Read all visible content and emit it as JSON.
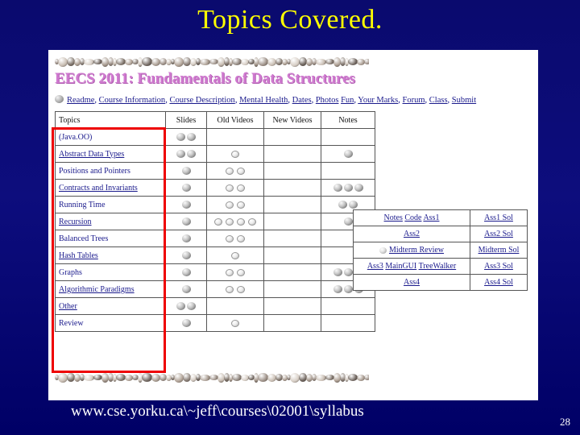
{
  "slide": {
    "title": "Topics Covered.",
    "footer_url": "www.cse.yorku.ca\\~jeff\\courses\\02001\\syllabus",
    "page_number": "28",
    "background_color": "#00007a",
    "title_color": "#ffff00"
  },
  "page": {
    "course_heading": "EECS 2011: Fundamentals of Data Structures",
    "heading_color": "#d07ad0",
    "nav_links": [
      "Readme",
      "Course Information",
      "Course Description",
      "Mental Health",
      "Dates",
      "Photos",
      "Fun",
      "Your Marks",
      "Forum",
      "Class",
      "Submit"
    ],
    "nav_bullet_icon": "rock-bullet-icon"
  },
  "topics_table": {
    "headers": [
      "Topics",
      "Slides",
      "Old Videos",
      "New Videos",
      "Notes"
    ],
    "rows": [
      {
        "topic": "(Java.OO)",
        "linked": false,
        "slides": 2,
        "old_videos": 0,
        "new_videos": 0,
        "notes": 0
      },
      {
        "topic": "Abstract Data Types",
        "linked": true,
        "slides": 2,
        "old_videos": 1,
        "new_videos": 0,
        "notes": 1
      },
      {
        "topic": "Positions and Pointers",
        "linked": false,
        "slides": 1,
        "old_videos": 2,
        "new_videos": 0,
        "notes": 0
      },
      {
        "topic": "Contracts and Invariants",
        "linked": true,
        "slides": 1,
        "old_videos": 2,
        "new_videos": 0,
        "notes": 3
      },
      {
        "topic": "Running Time",
        "linked": false,
        "slides": 1,
        "old_videos": 2,
        "new_videos": 0,
        "notes": 2
      },
      {
        "topic": "Recursion",
        "linked": true,
        "slides": 1,
        "old_videos": 4,
        "new_videos": 0,
        "notes": 1
      },
      {
        "topic": "Balanced Trees",
        "linked": false,
        "slides": 1,
        "old_videos": 2,
        "new_videos": 0,
        "notes": 0
      },
      {
        "topic": "Hash Tables",
        "linked": true,
        "slides": 1,
        "old_videos": 1,
        "new_videos": 0,
        "notes": 0
      },
      {
        "topic": "Graphs",
        "linked": false,
        "slides": 1,
        "old_videos": 2,
        "new_videos": 0,
        "notes": 3
      },
      {
        "topic": "Algorithmic Paradigms",
        "linked": true,
        "slides": 1,
        "old_videos": 2,
        "new_videos": 0,
        "notes": 3
      },
      {
        "topic": "Other",
        "linked": true,
        "slides": 2,
        "old_videos": 0,
        "new_videos": 0,
        "notes": 0
      },
      {
        "topic": "Review",
        "linked": false,
        "slides": 1,
        "old_videos": 1,
        "new_videos": 0,
        "notes": 0
      }
    ],
    "highlight_color": "#ee0000",
    "highlight_target": "Topics column"
  },
  "assignments_table": {
    "rows": [
      {
        "left_links": [
          "Notes",
          "Code",
          "Ass1"
        ],
        "left_icon": false,
        "right_link": "Ass1 Sol"
      },
      {
        "left_links": [
          "Ass2"
        ],
        "left_icon": false,
        "right_link": "Ass2 Sol"
      },
      {
        "left_links": [
          "Midterm Review"
        ],
        "left_icon": true,
        "right_link": "Midterm Sol"
      },
      {
        "left_links": [
          "Ass3",
          "MainGUI",
          "TreeWalker"
        ],
        "left_icon": false,
        "right_link": "Ass3 Sol"
      },
      {
        "left_links": [
          "Ass4"
        ],
        "left_icon": false,
        "right_link": "Ass4 Sol"
      }
    ]
  }
}
